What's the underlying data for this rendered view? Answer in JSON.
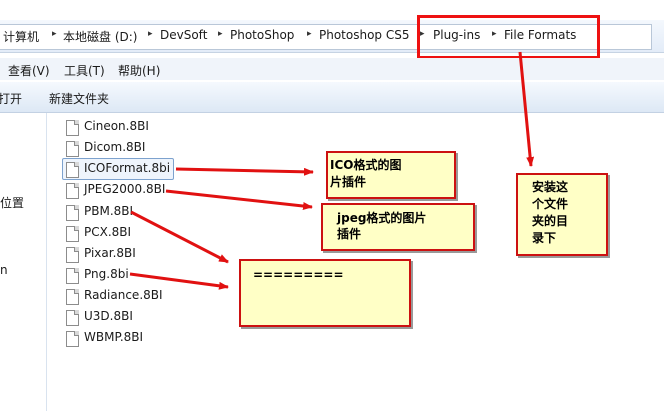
{
  "breadcrumbs": [
    "计算机",
    "本地磁盘 (D:)",
    "DevSoft",
    "PhotoShop",
    "Photoshop CS5",
    "Plug-ins",
    "File Formats"
  ],
  "menu": [
    "查看(V)",
    "工具(T)",
    "帮助(H)"
  ],
  "toolbar": {
    "open": "打开",
    "new_folder": "新建文件夹"
  },
  "nav": {
    "location": "位置",
    "n": "n"
  },
  "files": [
    "Cineon.8BI",
    "Dicom.8BI",
    "ICOFormat.8bi",
    "JPEG2000.8BI",
    "PBM.8BI",
    "PCX.8BI",
    "Pixar.8BI",
    "Png.8bi",
    "Radiance.8BI",
    "U3D.8BI",
    "WBMP.8BI"
  ],
  "selected_file": "ICOFormat.8bi",
  "notes": {
    "ico": [
      "ICO格式的图",
      "片插件"
    ],
    "jpeg": [
      "jpeg格式的图片",
      "插件"
    ],
    "png": "=========",
    "dir": [
      "安装这",
      "个文件",
      "夹的目",
      "录下"
    ]
  },
  "colors": {
    "note_bg": "#ffffc6",
    "arrow": "#e11111",
    "select": "#7da2ce"
  }
}
